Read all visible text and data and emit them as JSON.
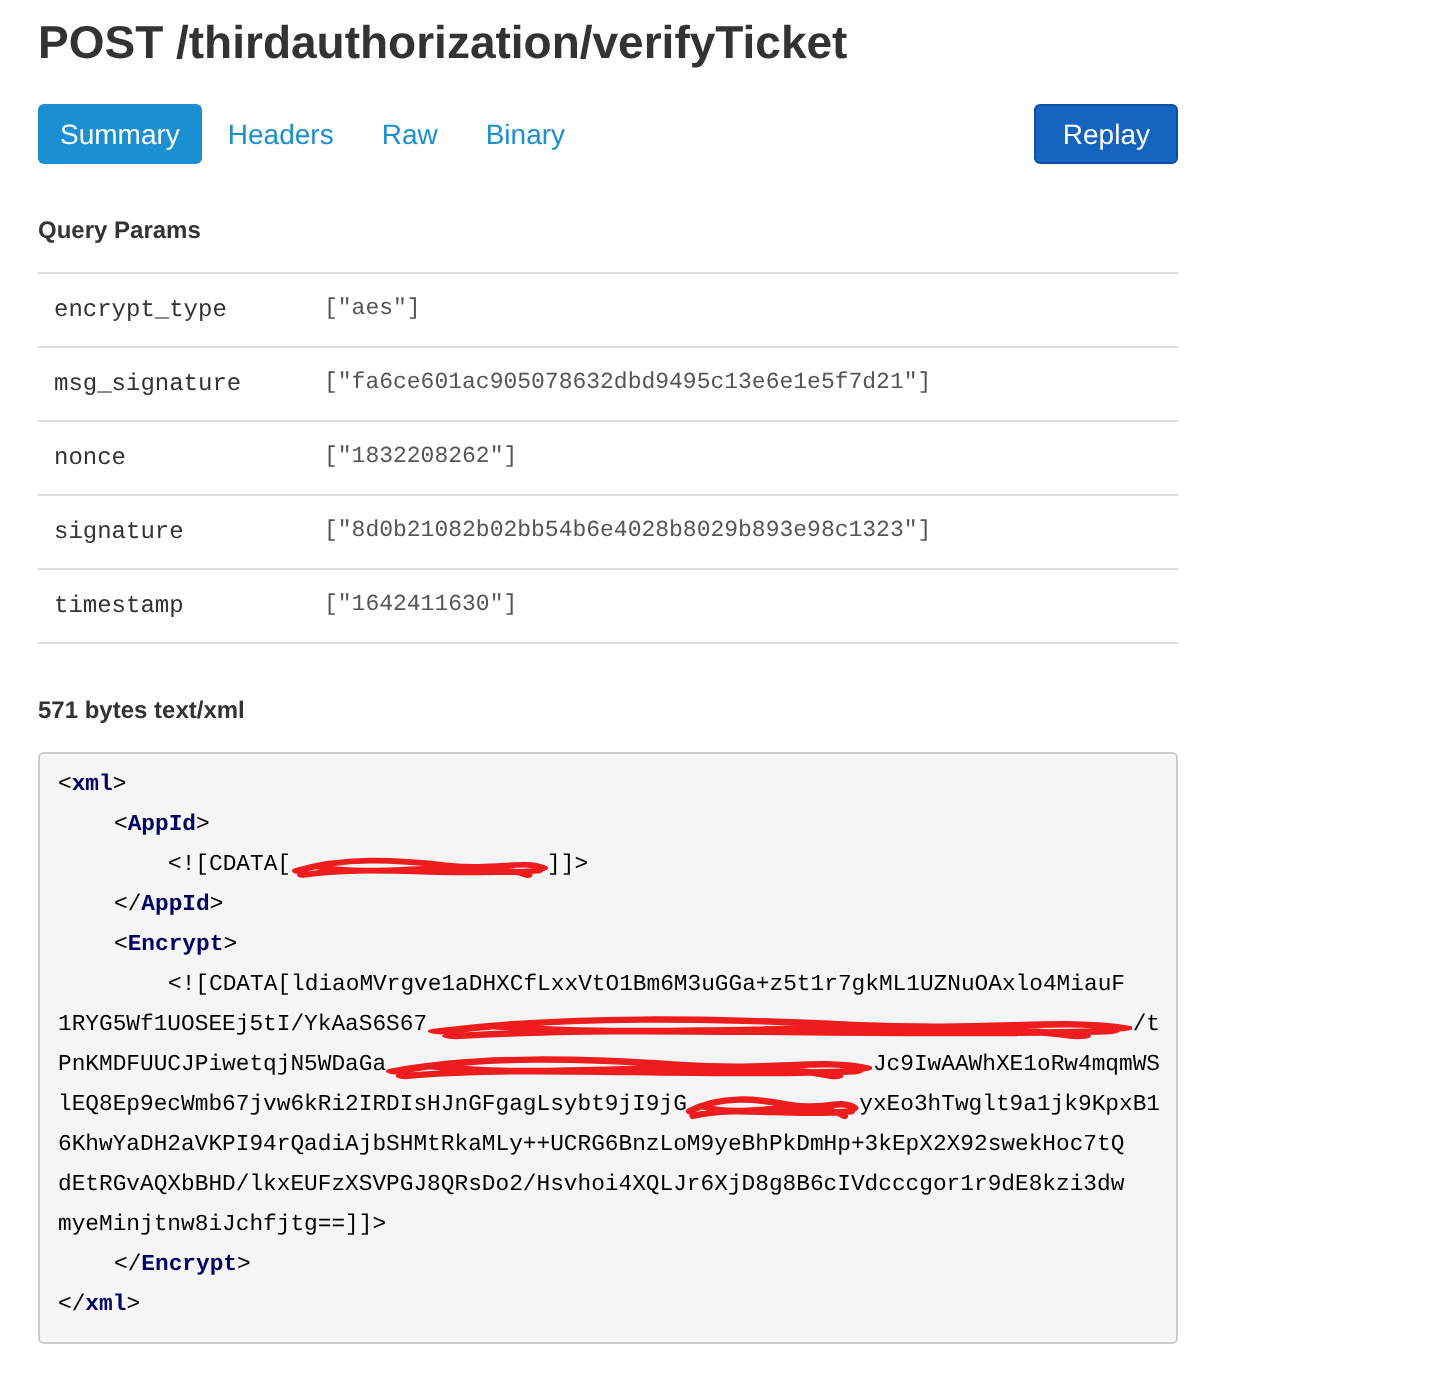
{
  "title": "POST /thirdauthorization/verifyTicket",
  "tabs": [
    {
      "label": "Summary",
      "selected": true
    },
    {
      "label": "Headers",
      "selected": false
    },
    {
      "label": "Raw",
      "selected": false
    },
    {
      "label": "Binary",
      "selected": false
    }
  ],
  "replay_button": "Replay",
  "query_params": {
    "heading": "Query Params",
    "rows": [
      {
        "name": "encrypt_type",
        "value": "[\"aes\"]"
      },
      {
        "name": "msg_signature",
        "value": "[\"fa6ce601ac905078632dbd9495c13e6e1e5f7d21\"]"
      },
      {
        "name": "nonce",
        "value": "[\"1832208262\"]"
      },
      {
        "name": "signature",
        "value": "[\"8d0b21082b02bb54b6e4028b8029b893e98c1323\"]"
      },
      {
        "name": "timestamp",
        "value": "[\"1642411630\"]"
      }
    ]
  },
  "body": {
    "heading": "571 bytes text/xml",
    "lines": [
      {
        "parts": [
          {
            "kind": "text",
            "text": "<**xml**>"
          }
        ],
        "children": [
          {
            "parts": [
              {
                "kind": "text",
                "text": "<**AppId**>"
              }
            ],
            "children": [
              {
                "parts": [
                  {
                    "kind": "text",
                    "text": "<![CDATA["
                  },
                  {
                    "kind": "redacted"
                  },
                  {
                    "kind": "text",
                    "text": "]]>"
                  }
                ]
              }
            ]
          },
          {
            "parts": [
              {
                "kind": "text",
                "text": "</**AppId**>"
              }
            ]
          },
          {
            "parts": [
              {
                "kind": "text",
                "text": "<**Encrypt**>"
              }
            ],
            "children": [
              {
                "parts": [
                  {
                    "kind": "text",
                    "text": "<![CDATA[ldiaoMVrgve1aDHXCfLxxVtO1Bm6M3uGGa+z5t1r7gkML1UZNuOAxlo4MiauF"
                  }
                ],
                "continuation": [
                  {
                    "parts": [
                      {
                        "kind": "text",
                        "text": "1RYG5Wf1UOSEEj5tI/YkAaS6S67"
                      },
                      {
                        "kind": "redacted"
                      },
                      {
                        "kind": "text",
                        "text": "/t"
                      }
                    ]
                  },
                  {
                    "parts": [
                      {
                        "kind": "text",
                        "text": "PnKMDFUUCJPiwetqjN5WDaGa"
                      },
                      {
                        "kind": "redacted"
                      },
                      {
                        "kind": "text",
                        "text": "Jc9IwAAWhXE1oRw4mqmWS"
                      }
                    ]
                  },
                  {
                    "parts": [
                      {
                        "kind": "text",
                        "text": "lEQ8Ep9ecWmb67jvw6kRi2IRDIsHJnGFgagLsybt9jI9jG"
                      },
                      {
                        "kind": "redacted"
                      },
                      {
                        "kind": "text",
                        "text": "yxEo3hTwglt9a1jk9KpxB1"
                      }
                    ]
                  },
                  {
                    "parts": [
                      {
                        "kind": "text",
                        "text": "6KhwYaDH2aVKPI94rQadiAjbSHMtRkaMLy++UCRG6BnzLoM9yeBhPkDmHp+3kEpX2X92swekHoc7tQ"
                      }
                    ]
                  },
                  {
                    "parts": [
                      {
                        "kind": "text",
                        "text": "dEtRGvAQXbBHD/lkxEUFzXSVPGJ8QRsDo2/Hsvhoi4XQLJr6XjD8g8B6cIVdcccgor1r9dE8kzi3dw"
                      }
                    ]
                  },
                  {
                    "parts": [
                      {
                        "kind": "text",
                        "text": "myeMinjtnw8iJchfjtg==]]>"
                      }
                    ]
                  }
                ]
              }
            ]
          },
          {
            "parts": [
              {
                "kind": "text",
                "text": "</**Encrypt**>"
              }
            ]
          }
        ]
      },
      {
        "parts": [
          {
            "kind": "text",
            "text": "</**xml**>"
          }
        ]
      }
    ]
  }
}
